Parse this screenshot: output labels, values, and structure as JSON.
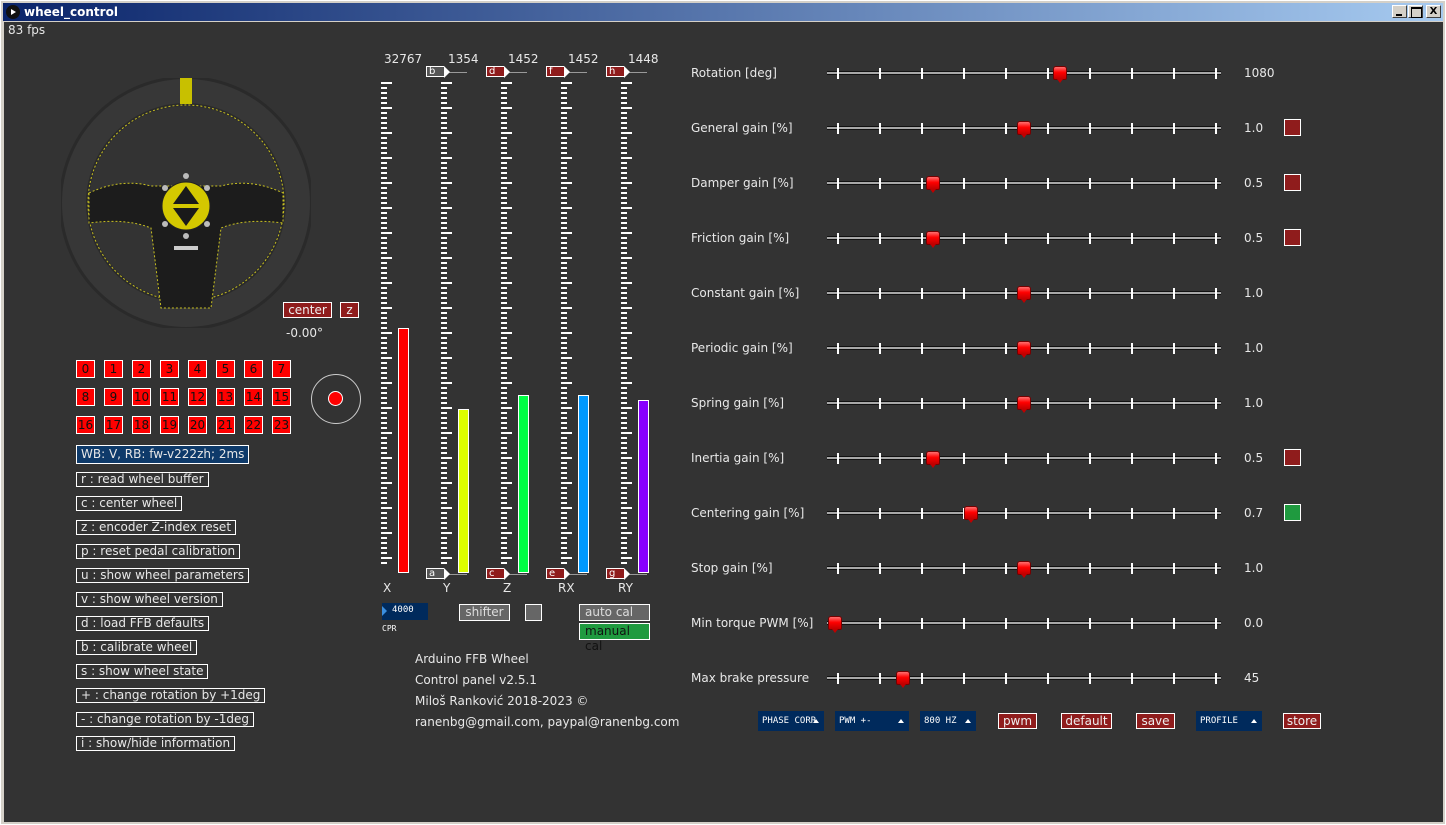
{
  "window": {
    "title": "wheel_control",
    "fps": "83 fps",
    "minimize_label": "",
    "maximize_label": "",
    "close_label": "X"
  },
  "wheel": {
    "center_label": "center",
    "z_label": "z",
    "angle": "-0.00°"
  },
  "buttons": [
    "0",
    "1",
    "2",
    "3",
    "4",
    "5",
    "6",
    "7",
    "8",
    "9",
    "10",
    "11",
    "12",
    "13",
    "14",
    "15",
    "16",
    "17",
    "18",
    "19",
    "20",
    "21",
    "22",
    "23"
  ],
  "status": "WB: V, RB: fw-v222zh; 2ms",
  "commands": [
    "r : read wheel buffer",
    "c : center wheel",
    "z : encoder Z-index reset",
    "p : reset pedal calibration",
    "u : show wheel parameters",
    "v : show wheel version",
    "d : load FFB defaults",
    "b : calibrate wheel",
    "s : show wheel state",
    "+ : change rotation by +1deg",
    "- : change rotation by -1deg",
    "i : show/hide information"
  ],
  "axes": [
    {
      "name": "X",
      "value": "32767",
      "fill": 0.51,
      "color": "#ff0000",
      "top_flag": "",
      "bottom_flag": ""
    },
    {
      "name": "Y",
      "value": "1354",
      "fill": 0.34,
      "color": "#ddff00",
      "top_flag": "b",
      "bottom_flag": "a",
      "flag_color": "#555555"
    },
    {
      "name": "Z",
      "value": "1452",
      "fill": 0.37,
      "color": "#00ff44",
      "top_flag": "d",
      "bottom_flag": "c",
      "flag_color": "#8f1c1c"
    },
    {
      "name": "RX",
      "value": "1452",
      "fill": 0.37,
      "color": "#0099ff",
      "top_flag": "f",
      "bottom_flag": "e",
      "flag_color": "#8f1c1c"
    },
    {
      "name": "RY",
      "value": "1448",
      "fill": 0.36,
      "color": "#8800ff",
      "top_flag": "h",
      "bottom_flag": "g",
      "flag_color": "#8f1c1c"
    }
  ],
  "cpr": {
    "value": "4000",
    "label": "CPR"
  },
  "shifter_label": "shifter",
  "auto_cal_label": "auto cal",
  "manual_cal_label": "manual cal",
  "info": [
    "Arduino FFB Wheel",
    "Control panel v2.5.1",
    "Miloš Ranković 2018-2023 ©",
    "ranenbg@gmail.com, paypal@ranenbg.com"
  ],
  "sliders": [
    {
      "label": "Rotation [deg]",
      "value": "1080",
      "position": 0.595,
      "indicator": ""
    },
    {
      "label": "General gain [%]",
      "value": "1.0",
      "position": 0.5,
      "indicator": "#8f1c1c"
    },
    {
      "label": "Damper gain [%]",
      "value": "0.5",
      "position": 0.26,
      "indicator": "#8f1c1c"
    },
    {
      "label": "Friction gain [%]",
      "value": "0.5",
      "position": 0.26,
      "indicator": "#8f1c1c"
    },
    {
      "label": "Constant gain [%]",
      "value": "1.0",
      "position": 0.5,
      "indicator": ""
    },
    {
      "label": "Periodic gain [%]",
      "value": "1.0",
      "position": 0.5,
      "indicator": ""
    },
    {
      "label": "Spring gain [%]",
      "value": "1.0",
      "position": 0.5,
      "indicator": ""
    },
    {
      "label": "Inertia gain [%]",
      "value": "0.5",
      "position": 0.26,
      "indicator": "#8f1c1c"
    },
    {
      "label": "Centering gain [%]",
      "value": "0.7",
      "position": 0.36,
      "indicator": "#1f9a3f"
    },
    {
      "label": "Stop gain [%]",
      "value": "1.0",
      "position": 0.5,
      "indicator": ""
    },
    {
      "label": "Min torque PWM [%]",
      "value": "0.0",
      "position": 0.0,
      "indicator": ""
    },
    {
      "label": "Max brake pressure",
      "value": "45",
      "position": 0.18,
      "indicator": ""
    }
  ],
  "bottom_controls": {
    "phase_corr": "PHASE CORR",
    "pwm_mode": "PWM +-",
    "freq": "800 HZ",
    "pwm_label": "pwm",
    "default_label": "default",
    "save_label": "save",
    "profile": "PROFILE",
    "store_label": "store"
  }
}
